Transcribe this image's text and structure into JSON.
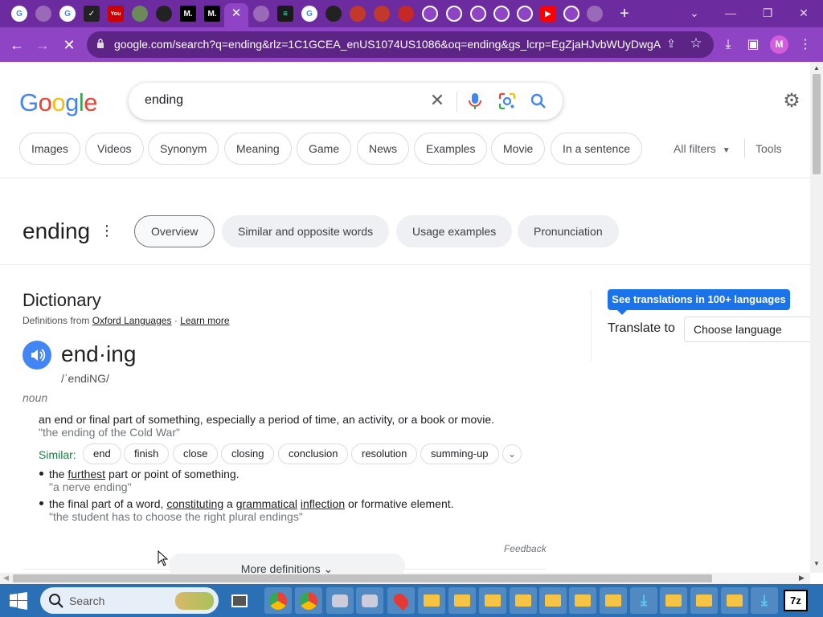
{
  "browser": {
    "tab_count_visible": 25,
    "active_tab_close": "✕",
    "new_tab": "+",
    "url": "google.com/search?q=ending&rlz=1C1GCEA_enUS1074US1086&oq=ending&gs_lcrp=EgZjaHJvbWUyDwgA...",
    "profile_initial": "M",
    "theme_color": "#6c2b9e"
  },
  "google": {
    "logo": [
      "G",
      "o",
      "o",
      "g",
      "l",
      "e"
    ],
    "logo_colors": [
      "#4285f4",
      "#ea4335",
      "#fbbc05",
      "#4285f4",
      "#34a853",
      "#ea4335"
    ],
    "query": "ending",
    "filter_chips": [
      "Images",
      "Videos",
      "Synonym",
      "Meaning",
      "Game",
      "News",
      "Examples",
      "Movie",
      "In a sentence"
    ],
    "all_filters": "All filters",
    "tools": "Tools"
  },
  "word_panel": {
    "title": "ending",
    "tabs": [
      "Overview",
      "Similar and opposite words",
      "Usage examples",
      "Pronunciation"
    ],
    "active_tab": "Overview"
  },
  "dictionary": {
    "title": "Dictionary",
    "source_prefix": "Definitions from",
    "source": "Oxford Languages",
    "separator": "·",
    "learn_more": "Learn more",
    "headword": "end·ing",
    "phonetic": "/ˈendiNG/",
    "part_of_speech": "noun",
    "def1": "an end or final part of something, especially a period of time, an activity, or a book or movie.",
    "ex1": "\"the ending of the Cold War\"",
    "similar_label": "Similar:",
    "similar": [
      "end",
      "finish",
      "close",
      "closing",
      "conclusion",
      "resolution",
      "summing-up"
    ],
    "def2_a": "the ",
    "def2_link": "furthest",
    "def2_b": " part or point of something.",
    "ex2": "\"a nerve ending\"",
    "def3_a": "the final part of a word, ",
    "def3_l1": "constituting",
    "def3_b": " a ",
    "def3_l2": "grammatical",
    "def3_c": " ",
    "def3_l3": "inflection",
    "def3_d": " or formative element.",
    "ex3": "\"the student has to choose the right plural endings\"",
    "feedback": "Feedback",
    "more_definitions": "More definitions"
  },
  "translate": {
    "button": "See translations in 100+ languages",
    "label": "Translate to",
    "select": "Choose language"
  },
  "taskbar": {
    "search_placeholder": "Search",
    "seven_zip": "7z"
  }
}
